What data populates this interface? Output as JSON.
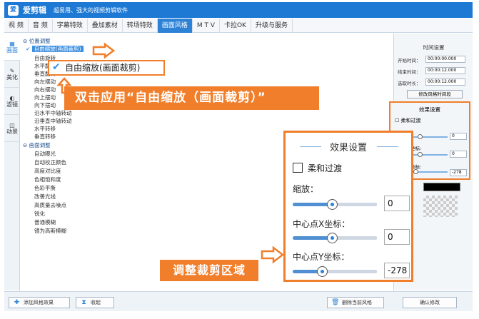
{
  "app": {
    "name": "爱剪辑",
    "slogan": "超易用、强大的视频剪辑软件"
  },
  "menu": [
    "视 频",
    "音 频",
    "字幕特效",
    "叠加素材",
    "转场特效",
    "画面风格",
    "M T V",
    "卡拉OK",
    "升级与服务"
  ],
  "active_menu": "画面风格",
  "left_tabs": [
    "画面",
    "美化",
    "滤镜",
    "动景"
  ],
  "list": {
    "group1": "位置调整",
    "items1": [
      "自由缩放(画面裁剪)",
      "自由旋转",
      "水平翻转",
      "垂直翻转",
      "向左摆动",
      "向右摆动",
      "向上摆动",
      "向下摆动",
      "沿水平中轴转动",
      "沿垂直中轴转动",
      "水平转移",
      "垂直转移"
    ],
    "group2": "画面调整",
    "items2": [
      "自动曝光",
      "自动校正颜色",
      "高度对比度",
      "色相饱和度",
      "色彩平衡",
      "改善光线",
      "高质量去噪点",
      "锐化",
      "普通模糊",
      "镜为高斯模糊"
    ]
  },
  "time_settings": {
    "title": "时间设置",
    "start_label": "开始时间：",
    "start": "00:00:00.000",
    "end_label": "结束时间：",
    "end": "00:00:12.000",
    "duration_label": "选取时长：",
    "duration": "00:00:12.000",
    "edit_btn": "修改风格时间段"
  },
  "small_effect": {
    "title": "效果设置",
    "check": "柔和过渡",
    "val1": "0",
    "val2": "0",
    "val3": "-278",
    "xl": "坐标:",
    "yl": "坐标:"
  },
  "bottom": {
    "add": "添加风格效果",
    "fold": "收起",
    "delete": "删除当前风格",
    "confirm": "确认修改"
  },
  "callout_item": "自由缩放(画面裁剪)",
  "banner_apply": "双击应用“自由缩放（画面裁剪）”",
  "banner_adjust": "调整裁剪区域",
  "effect": {
    "title": "效果设置",
    "soft": "柔和过渡",
    "zoom_label": "缩放：",
    "zoom": "0",
    "cx_label": "中心点X坐标：",
    "cx": "0",
    "cy_label": "中心点Y坐标：",
    "cy": "-278"
  },
  "colors": {
    "accent": "#f07e2a",
    "brand": "#1d79d4"
  }
}
